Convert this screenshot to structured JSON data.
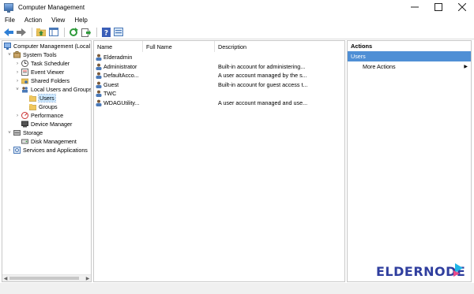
{
  "window": {
    "title": "Computer Management",
    "controls": [
      "minimize",
      "maximize",
      "close"
    ]
  },
  "menu": [
    "File",
    "Action",
    "View",
    "Help"
  ],
  "toolbar": {
    "buttons": [
      "back-arrow-icon",
      "forward-arrow-icon",
      "up-folder-icon",
      "show-hide-tree-icon",
      "refresh-icon",
      "export-list-icon",
      "help-icon",
      "properties-icon"
    ]
  },
  "tree": {
    "items": [
      {
        "label": "Computer Management (Local",
        "level": 0,
        "expander": "",
        "icon": "computer-management-icon"
      },
      {
        "label": "System Tools",
        "level": 1,
        "expander": "v",
        "icon": "tools-icon"
      },
      {
        "label": "Task Scheduler",
        "level": 2,
        "expander": ">",
        "icon": "clock-icon"
      },
      {
        "label": "Event Viewer",
        "level": 2,
        "expander": ">",
        "icon": "event-viewer-icon"
      },
      {
        "label": "Shared Folders",
        "level": 2,
        "expander": ">",
        "icon": "shared-folder-icon"
      },
      {
        "label": "Local Users and Groups",
        "level": 2,
        "expander": "v",
        "icon": "users-groups-icon"
      },
      {
        "label": "Users",
        "level": 3,
        "expander": "",
        "icon": "folder-icon",
        "selected": true
      },
      {
        "label": "Groups",
        "level": 3,
        "expander": "",
        "icon": "folder-icon"
      },
      {
        "label": "Performance",
        "level": 2,
        "expander": ">",
        "icon": "performance-icon"
      },
      {
        "label": "Device Manager",
        "level": 2,
        "expander": "",
        "icon": "device-manager-icon"
      },
      {
        "label": "Storage",
        "level": 1,
        "expander": "v",
        "icon": "storage-icon"
      },
      {
        "label": "Disk Management",
        "level": 2,
        "expander": "",
        "icon": "disk-icon"
      },
      {
        "label": "Services and Applications",
        "level": 1,
        "expander": ">",
        "icon": "services-icon"
      }
    ]
  },
  "list": {
    "columns": [
      "Name",
      "Full Name",
      "Description"
    ],
    "rows": [
      {
        "name": "Elderadmin",
        "full_name": "",
        "description": ""
      },
      {
        "name": "Administrator",
        "full_name": "",
        "description": "Built-in account for administering..."
      },
      {
        "name": "DefaultAcco...",
        "full_name": "",
        "description": "A user account managed by the s..."
      },
      {
        "name": "Guest",
        "full_name": "",
        "description": "Built-in account for guest access t..."
      },
      {
        "name": "TWC",
        "full_name": "",
        "description": ""
      },
      {
        "name": "WDAGUtility...",
        "full_name": "",
        "description": "A user account managed and use..."
      }
    ]
  },
  "actions": {
    "header": "Actions",
    "section": "Users",
    "items": [
      {
        "label": "More Actions"
      }
    ]
  },
  "watermark": {
    "text": "eldernode"
  },
  "colors": {
    "selection_bg": "#cce8ff",
    "actions_section_bg": "#4f8fd5",
    "watermark_text": "#2f3e9e",
    "watermark_accent": "#1fb5e8"
  }
}
